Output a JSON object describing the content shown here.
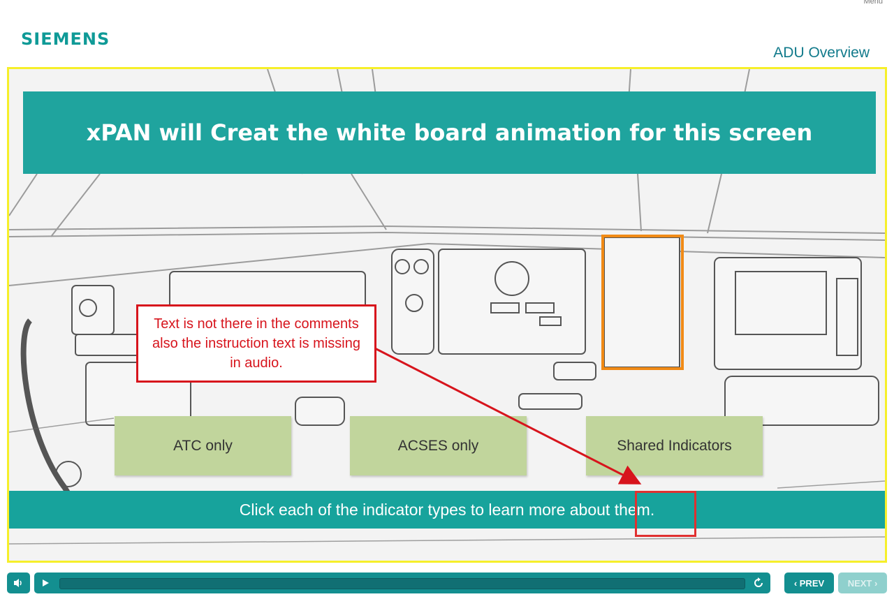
{
  "header": {
    "menu_label": "Menu",
    "logo_text": "SIEMENS",
    "page_title": "ADU Overview"
  },
  "slide": {
    "heading": "xPAN will Creat the white board animation for this screen",
    "callout": "Text is not there in the comments also the instruction text is missing in audio.",
    "options": [
      {
        "label": "ATC only"
      },
      {
        "label": "ACSES only"
      },
      {
        "label": "Shared Indicators"
      }
    ],
    "instruction": "Click each of the indicator types to learn more about them."
  },
  "player": {
    "volume_icon": "speaker-icon",
    "play_icon": "play-icon",
    "replay_icon": "replay-icon",
    "prev_label": "PREV",
    "next_label": "NEXT",
    "progress": 0
  },
  "colors": {
    "brand_teal": "#1fa49e",
    "button_green": "#c1d59c",
    "highlight_orange": "#f08a16",
    "annotation_red": "#d7141c",
    "stage_border_yellow": "#f6ef2a"
  }
}
